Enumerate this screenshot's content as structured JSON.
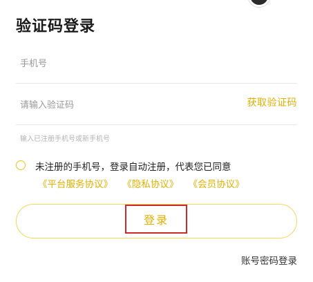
{
  "page": {
    "title": "验证码登录"
  },
  "form": {
    "phone_placeholder": "手机号",
    "code_placeholder": "请输入验证码",
    "get_code_label": "获取验证码",
    "hint": "输入已注册手机号或新手机号"
  },
  "agreement": {
    "text": "未注册的手机号，登录自动注册，代表您已同意",
    "links": [
      "《平台服务协议》",
      "《隐私协议》",
      "《会员协议》"
    ]
  },
  "actions": {
    "login_label": "登录",
    "password_login_label": "账号密码登录"
  },
  "colors": {
    "accent": "#e2b000",
    "button_border": "#f5d65a",
    "highlight_box": "#cc2a2a"
  }
}
